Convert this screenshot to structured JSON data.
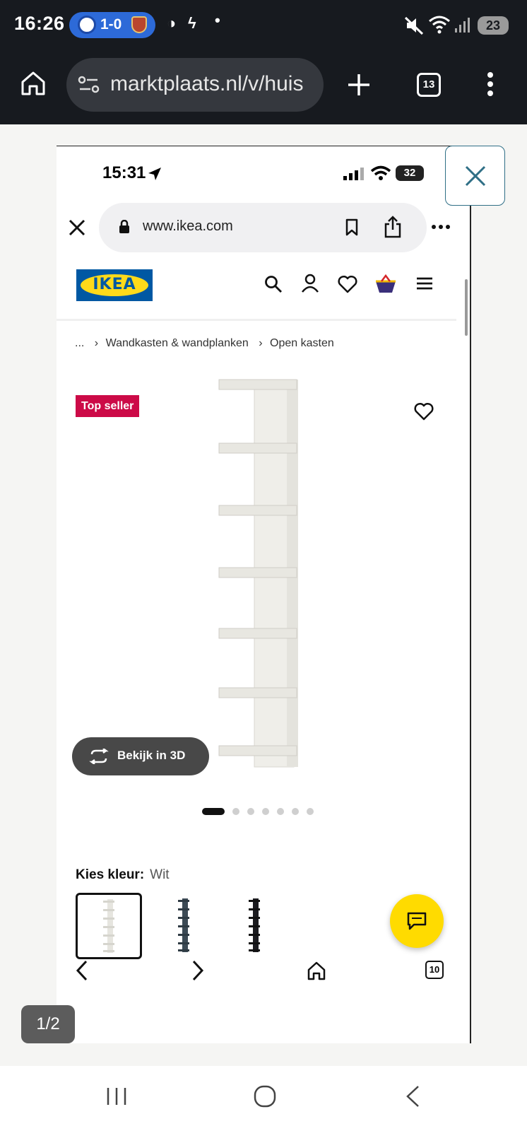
{
  "status_bar": {
    "time": "16:26",
    "score": "1-0",
    "battery": "23"
  },
  "browser": {
    "url": "marktplaats.nl/v/huis",
    "tab_count": "13"
  },
  "screenshot": {
    "ios_time": "15:31",
    "ios_battery": "32",
    "safari_url": "www.ikea.com",
    "breadcrumb": {
      "ellipsis": "...",
      "item1": "Wandkasten & wandplanken",
      "item2": "Open kasten"
    },
    "brand": "IKEA",
    "badge": "Top seller",
    "view3d_label": "Bekijk in 3D",
    "color_label": "Kies kleur:",
    "color_value": "Wit",
    "carousel": {
      "total": 7,
      "active": 1
    },
    "tabs_count": "10"
  },
  "viewer": {
    "counter": "1/2"
  },
  "colors": {
    "ikea_blue": "#0058a3",
    "ikea_yellow": "#ffda1a",
    "badge_red": "#cc0a47",
    "chat_yellow": "#ffdb00"
  }
}
